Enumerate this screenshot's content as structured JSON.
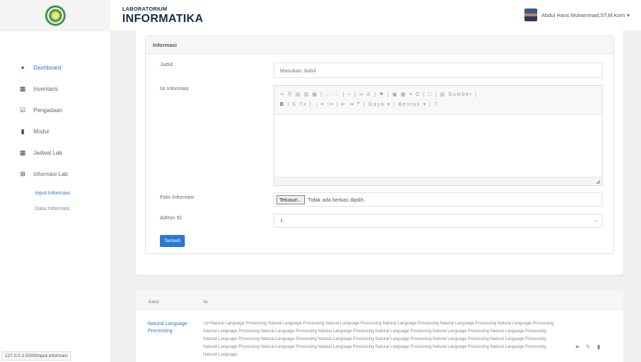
{
  "brand": {
    "small": "LABORATORIUM",
    "big": "INFORMATIKA"
  },
  "user": {
    "name": "Abdul Haris Muhammad,ST,M.Kom",
    "caret": "▾"
  },
  "sidebar": {
    "items": [
      {
        "label": "Dashboard",
        "icon": "●"
      },
      {
        "label": "Inventaris",
        "icon": "▦"
      },
      {
        "label": "Pengadaan",
        "icon": "☑"
      },
      {
        "label": "Modul",
        "icon": "▮"
      },
      {
        "label": "Jadwal Lab",
        "icon": "▦"
      },
      {
        "label": "Informasi Lab",
        "icon": "⊞"
      }
    ],
    "subitems": [
      {
        "label": "Input Informasi"
      },
      {
        "label": "Data Informasi"
      }
    ]
  },
  "status_url": "127.0.0.1:5000/input-informasi",
  "form": {
    "panel_title": "Informasi",
    "judul_label": "Judul",
    "judul_placeholder": "Masukan Judul",
    "isi_label": "Isi Informasi",
    "toolbar_row1": "✂ ⎘ ▤ ▥ ▦ | ← → | ⌁ | ∞ ⊘ | ⚑ | ▣ ▦ ≡ Ω | ⛶ | ▤ Sumber |",
    "toolbar_row2_bold": "B",
    "toolbar_row2": "I S Tx | ⋮≡ ⁝≡ | ⇤ ⇥ ❞ | Gaya ▾ | Bentuk ▾ | ?",
    "foto_label": "Foto Informasi",
    "file_button": "Telusuri...",
    "file_status": "Tidak ada berkas dipilih.",
    "admin_label": "Admin ID",
    "admin_value": "1",
    "submit_label": "Tambah"
  },
  "table": {
    "headers": {
      "judul": "Judul",
      "isi": "Isi"
    },
    "rows": [
      {
        "judul": "Natural Language Processing",
        "isi": "<p>Natural Language Processing Natural Language Processing Natural Language Processing Natural Language Processing Natural Language Processing Natural Language Processing Natural Language Processing Natural Language Processing Natural Language Processing Natural Language Processing Natural Language Processing Natural Language Processing Natural Language Processing Natural Language Processing Natural Language Processing Natural Language Processing Natural Language Processing Natural Language Processing Natural Language Processing Natural Language Processing Natural Language Processing Natural Language Processing Natural Language Processing Natural Language Processing Natural Language"
      }
    ]
  },
  "colors": {
    "accent": "#2a78d6",
    "brand_text": "#1a2e4a"
  }
}
